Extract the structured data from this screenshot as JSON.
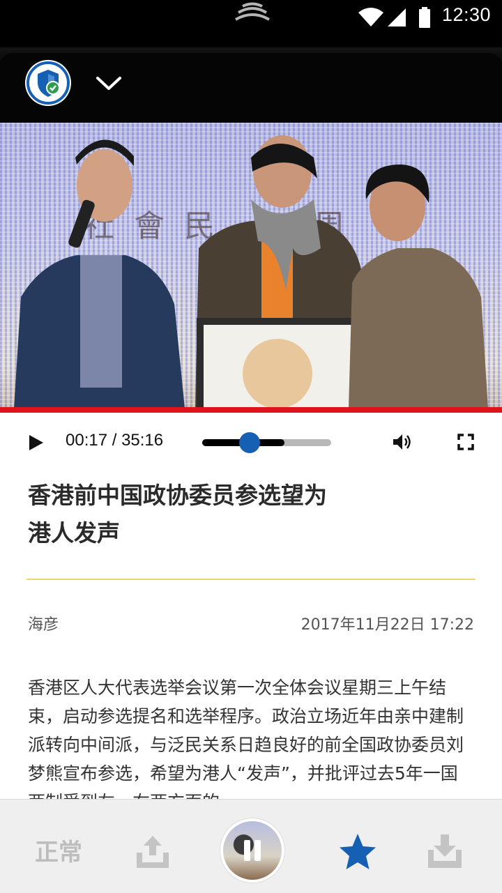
{
  "status_bar": {
    "time": "12:30",
    "icons": [
      "wifi-icon",
      "signal-icon",
      "battery-icon"
    ]
  },
  "header": {
    "shield_icon": "shield-check-icon",
    "collapse_icon": "chevron-down-icon"
  },
  "photo": {
    "banner_text": "社會民 一周"
  },
  "player": {
    "time": "00:17 / 35:16",
    "progress_fraction": 0.37,
    "buffered_fraction": 0.64,
    "accent_color": "#1560b2",
    "rule_color": "#e0121b"
  },
  "article": {
    "headline": "香港前中国政协委员参选望为港人发声",
    "author": "海彦",
    "date": "2017年11月22日 17:22",
    "body": "香港区人大代表选举会议第一次全体会议星期三上午结束，启动参选提名和选举程序。政治立场近年由亲中建制派转向中间派，与泛民关系日趋良好的前全国政协委员刘梦熊宣布参选，希望为港人“发声”，并批评过去5年一国两制受到左，右两方面的"
  },
  "bottom_bar": {
    "speed_label": "正常",
    "share_icon": "share-icon",
    "now_playing_icon": "pause-icon",
    "favorite_icon": "star-icon",
    "download_icon": "download-icon",
    "favorite_color": "#1560b2"
  }
}
